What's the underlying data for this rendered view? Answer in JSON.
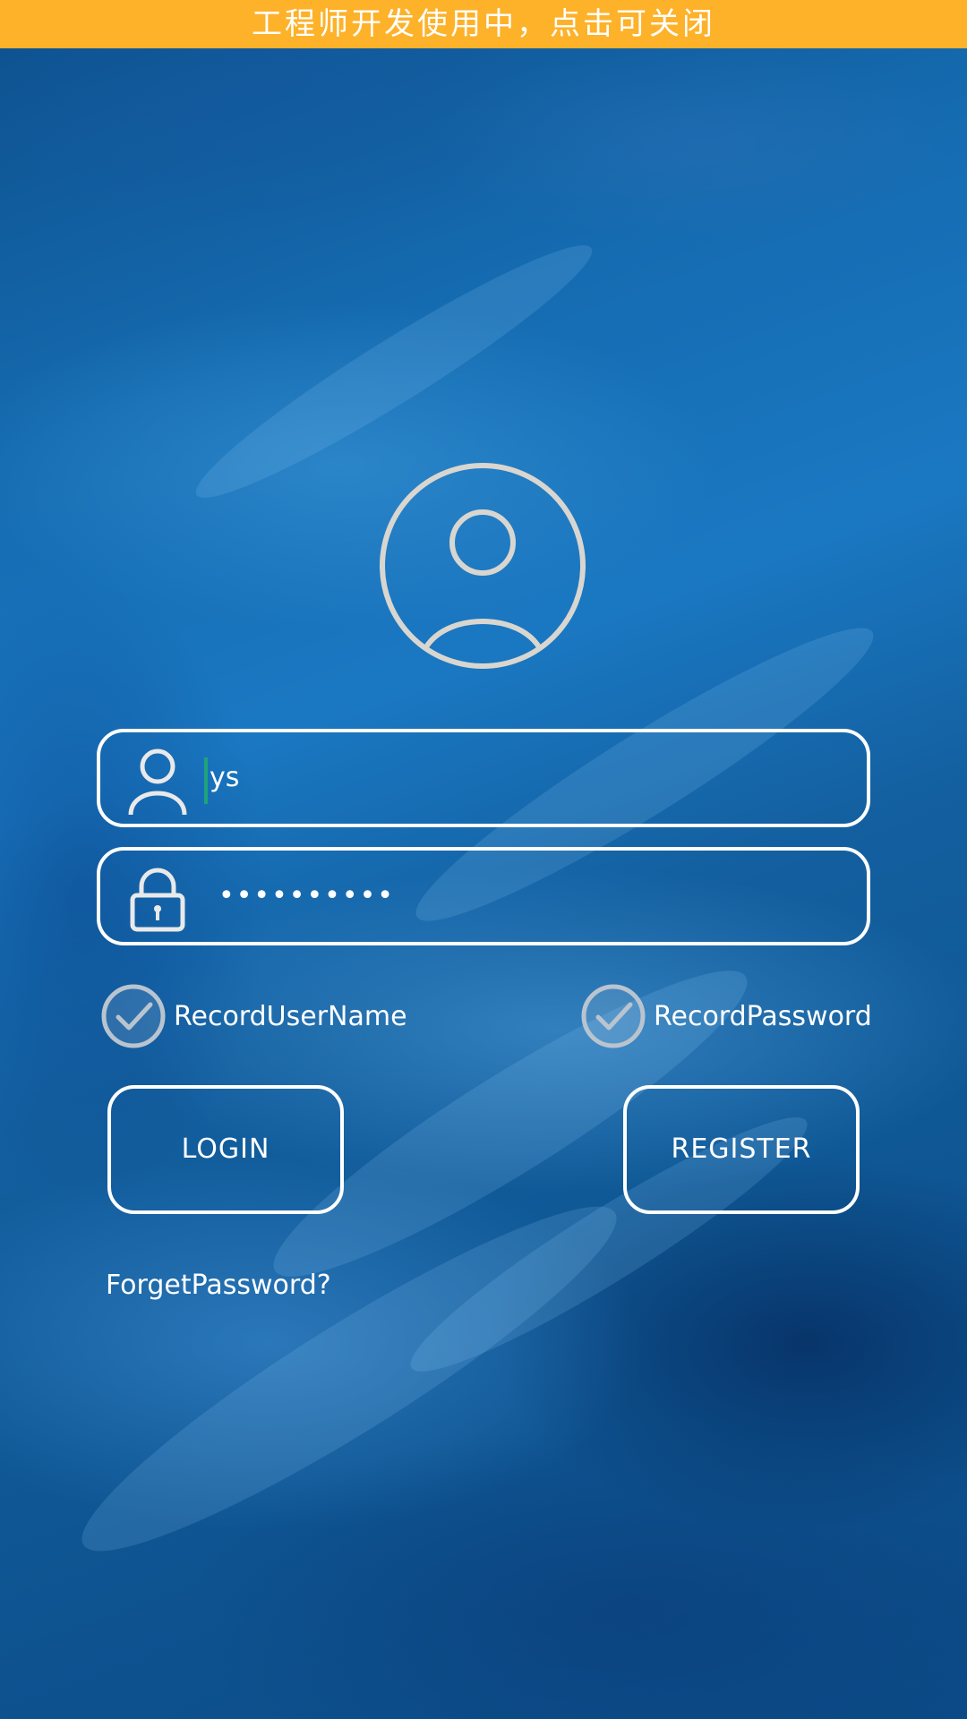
{
  "banner": {
    "text": "工程师开发使用中，点击可关闭",
    "color": "#fdb22a"
  },
  "avatar": {
    "icon": "account-circle-icon"
  },
  "username_field": {
    "value": "ys",
    "icon": "user-icon"
  },
  "password_field": {
    "value": "••••••••••",
    "icon": "lock-icon"
  },
  "remember": {
    "username_label": "RecordUserName",
    "password_label": "RecordPassword",
    "icon": "check-circle-icon"
  },
  "buttons": {
    "login": "LOGIN",
    "register": "REGISTER"
  },
  "forget_password": "ForgetPassword?"
}
